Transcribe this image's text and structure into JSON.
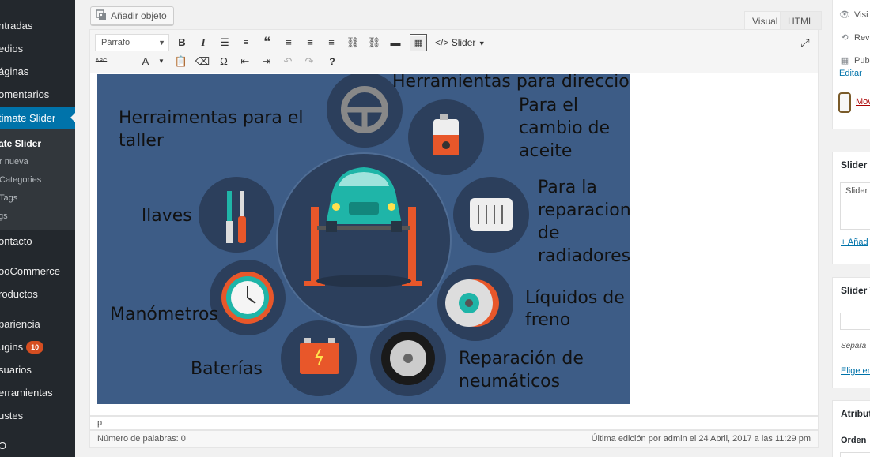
{
  "admin_menu": {
    "items": [
      {
        "label": "ntradas",
        "icon": "pin-icon"
      },
      {
        "label": "edios",
        "icon": "media-icon"
      },
      {
        "label": "áginas",
        "icon": "page-icon"
      },
      {
        "label": "omentarios",
        "icon": "comment-icon"
      },
      {
        "label": "timate Slider",
        "icon": "slider-icon"
      },
      {
        "label": "ontacto",
        "icon": "mail-icon"
      },
      {
        "label": "ooCommerce",
        "icon": "woo-icon"
      },
      {
        "label": "roductos",
        "icon": "product-icon"
      },
      {
        "label": "pariencia",
        "icon": "brush-icon"
      },
      {
        "label": "ugins",
        "icon": "plugin-icon",
        "badge": "10"
      },
      {
        "label": "suarios",
        "icon": "user-icon"
      },
      {
        "label": "erramientas",
        "icon": "tools-icon"
      },
      {
        "label": "ustes",
        "icon": "settings-icon"
      },
      {
        "label": "O",
        "icon": "seo-icon"
      }
    ],
    "submenu": [
      "ate Slider",
      "r nueva",
      "Categories",
      "Tags",
      "gs"
    ]
  },
  "editor": {
    "add_media_label": "Añadir objeto",
    "tabs": {
      "visual": "Visual",
      "html": "HTML"
    },
    "format_select": "Párrafo",
    "slider_button": "Slider",
    "path": "p",
    "word_count": "Número de palabras: 0",
    "last_edit": "Última edición por admin el 24 Abril, 2017 a las 11:29 pm"
  },
  "infographic": {
    "labels": {
      "direccion": "Herramientas para direccion",
      "taller_1": "Herraimentas para el",
      "taller_2": "taller",
      "aceite_1": "Para el",
      "aceite_2": "cambio de",
      "aceite_3": "aceite",
      "llaves": "llaves",
      "radiadores_1": "Para la",
      "radiadores_2": "reparacion",
      "radiadores_3": "de",
      "radiadores_4": "radiadores",
      "manometros": "Manómetros",
      "liquidos_1": "Líquidos de",
      "liquidos_2": "freno",
      "baterias": "Baterías",
      "neumaticos_1": "Reparación de",
      "neumaticos_2": "neumáticos"
    },
    "colors": {
      "background": "#3d5c86",
      "circle": "#2c3f5c",
      "car": "#1fb5a8",
      "lift": "#e8572a"
    }
  },
  "sidebar": {
    "publish_rows": [
      "Visi",
      "Rev",
      "Pub"
    ],
    "edit_link": "Editar",
    "move_link": "Mov",
    "slider_cat_title": "Slider C",
    "slider_cat_item": "Slider C",
    "add_link": "+ Añad",
    "slider_tags_title": "Slider T",
    "tags_note": "Separa",
    "choose_link": "Elige en",
    "attributes_title": "Atribut",
    "order_label": "Orden"
  }
}
